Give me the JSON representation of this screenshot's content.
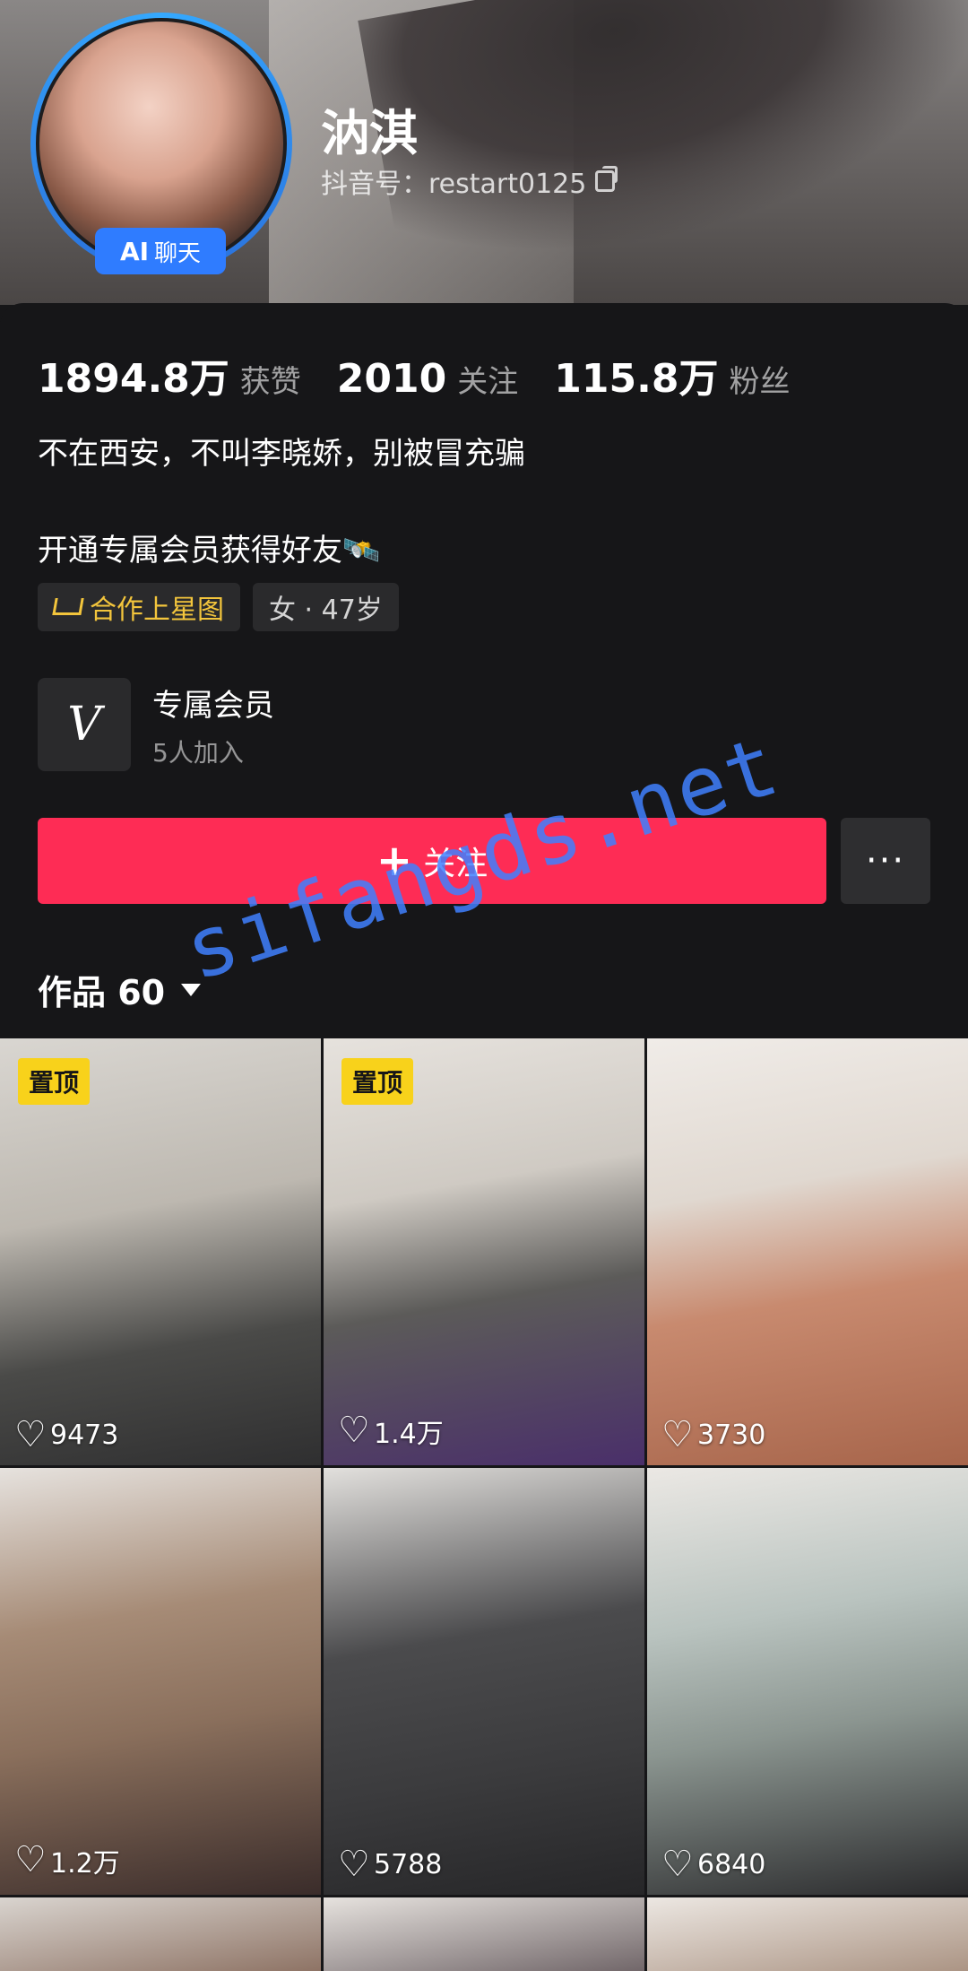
{
  "profile": {
    "nickname": "汭淇",
    "douyin_id": "抖音号：restart0125",
    "ai_badge": {
      "ai": "AI",
      "text": "聊天"
    }
  },
  "stats": [
    {
      "value": "1894.8万",
      "label": "获赞"
    },
    {
      "value": "2010",
      "label": "关注"
    },
    {
      "value": "115.8万",
      "label": "粉丝"
    }
  ],
  "bio": {
    "line1": "不在西安，不叫李晓娇，别被冒充骗",
    "line2": "开通专属会员获得好友🛰️"
  },
  "tags": {
    "star": "合作上星图",
    "gender_age": "女 · 47岁"
  },
  "membership": {
    "title": "专属会员",
    "subtitle": "5人加入"
  },
  "actions": {
    "follow": "关注",
    "more": "···"
  },
  "works_tab": {
    "label": "作品 60"
  },
  "grid": [
    {
      "pin": "置顶",
      "likes": "9473"
    },
    {
      "pin": "置顶",
      "likes": "1.4万"
    },
    {
      "pin": "",
      "likes": "3730"
    },
    {
      "pin": "",
      "likes": "1.2万"
    },
    {
      "pin": "",
      "likes": "5788"
    },
    {
      "pin": "",
      "likes": "6840"
    }
  ],
  "watermark": "sifangds.net",
  "colors": {
    "follow": "#fe2c55",
    "pin": "#f8d21b",
    "ai_badge": "#2f7cff",
    "star_tag": "#f3c53c"
  }
}
